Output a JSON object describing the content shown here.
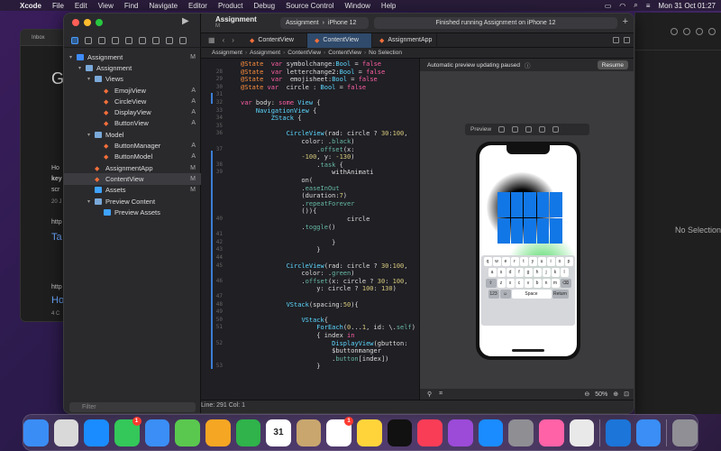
{
  "menubar": {
    "app": "Xcode",
    "items": [
      "File",
      "Edit",
      "View",
      "Find",
      "Navigate",
      "Editor",
      "Product",
      "Debug",
      "Source Control",
      "Window",
      "Help"
    ],
    "clock": "Mon 31 Oct  01:27"
  },
  "background_browser": {
    "tab": "Inbox",
    "heading": "G",
    "lines": [
      "Ho",
      "key",
      "scr",
      "20 J",
      "http",
      "Ta",
      "http",
      "Ho",
      "4 C"
    ]
  },
  "right_window": {
    "placeholder": "No Selection"
  },
  "sidebar": {
    "filter_placeholder": "Filter",
    "items": [
      {
        "label": "Assignment",
        "status": "M",
        "icon": "project-icon",
        "indent": 0,
        "disclosure": "▾"
      },
      {
        "label": "Assignment",
        "status": "",
        "icon": "folder-icon",
        "indent": 1,
        "disclosure": "▾"
      },
      {
        "label": "Views",
        "status": "",
        "icon": "folder-icon",
        "indent": 2,
        "disclosure": "▾"
      },
      {
        "label": "EmojiView",
        "status": "A",
        "icon": "swift-file-icon",
        "indent": 3,
        "disclosure": ""
      },
      {
        "label": "CircleView",
        "status": "A",
        "icon": "swift-file-icon",
        "indent": 3,
        "disclosure": ""
      },
      {
        "label": "DisplayView",
        "status": "A",
        "icon": "swift-file-icon",
        "indent": 3,
        "disclosure": ""
      },
      {
        "label": "ButtonView",
        "status": "A",
        "icon": "swift-file-icon",
        "indent": 3,
        "disclosure": ""
      },
      {
        "label": "Model",
        "status": "",
        "icon": "folder-icon",
        "indent": 2,
        "disclosure": "▾"
      },
      {
        "label": "ButtonManager",
        "status": "A",
        "icon": "swift-file-icon",
        "indent": 3,
        "disclosure": ""
      },
      {
        "label": "ButtonModel",
        "status": "A",
        "icon": "swift-file-icon",
        "indent": 3,
        "disclosure": ""
      },
      {
        "label": "AssignmentApp",
        "status": "M",
        "icon": "swift-file-icon",
        "indent": 2,
        "disclosure": ""
      },
      {
        "label": "ContentView",
        "status": "M",
        "icon": "swift-file-icon",
        "indent": 2,
        "disclosure": "",
        "selected": true
      },
      {
        "label": "Assets",
        "status": "M",
        "icon": "asset-catalog-icon",
        "indent": 2,
        "disclosure": ""
      },
      {
        "label": "Preview Content",
        "status": "",
        "icon": "folder-icon",
        "indent": 2,
        "disclosure": "▾"
      },
      {
        "label": "Preview Assets",
        "status": "",
        "icon": "asset-catalog-icon",
        "indent": 3,
        "disclosure": ""
      }
    ]
  },
  "toolbar": {
    "title": "Assignment",
    "subtitle": "M",
    "scheme": "Assignment",
    "device": "iPhone 12",
    "status": "Finished running Assignment on iPhone 12",
    "add": "+"
  },
  "tabs": [
    {
      "label": "ContentView",
      "active": false
    },
    {
      "label": "ContentView",
      "active": true
    },
    {
      "label": "AssignmentApp",
      "active": false
    }
  ],
  "breadcrumbs": [
    "Assignment",
    "Assignment",
    "ContentView",
    "ContentView",
    "No Selection"
  ],
  "editor": {
    "lines": [
      {
        "n": "",
        "t": "@State  var symbolchange:Bool = false"
      },
      {
        "n": "28",
        "t": "@State  var letterchange2:Bool = false"
      },
      {
        "n": "29",
        "t": "@State  var  emojisheet:Bool = false"
      },
      {
        "n": "30",
        "t": "@State var  circle : Bool = false"
      },
      {
        "n": "31",
        "t": ""
      },
      {
        "n": "32",
        "t": "var body: some View {"
      },
      {
        "n": "33",
        "t": "    NavigationView {"
      },
      {
        "n": "34",
        "t": "        ZStack {"
      },
      {
        "n": "35",
        "t": ""
      },
      {
        "n": "36",
        "t": "            CircleView(rad: circle ? 30:100,"
      },
      {
        "n": "",
        "t": "                color: .black)"
      },
      {
        "n": "37",
        "t": "                    .offset(x:"
      },
      {
        "n": "",
        "t": "                -100, y: -130)"
      },
      {
        "n": "38",
        "t": "                    .task {"
      },
      {
        "n": "39",
        "t": "                        withAnimati"
      },
      {
        "n": "",
        "t": "                on("
      },
      {
        "n": "",
        "t": "                .easeInOut"
      },
      {
        "n": "",
        "t": "                (duration:7)"
      },
      {
        "n": "",
        "t": "                .repeatForever"
      },
      {
        "n": "",
        "t": "                ()){"
      },
      {
        "n": "40",
        "t": "                            circle"
      },
      {
        "n": "",
        "t": "                .toggle()"
      },
      {
        "n": "41",
        "t": ""
      },
      {
        "n": "42",
        "t": "                        }"
      },
      {
        "n": "43",
        "t": "                    }"
      },
      {
        "n": "44",
        "t": ""
      },
      {
        "n": "45",
        "t": "            CircleView(rad: circle ? 30:100,"
      },
      {
        "n": "",
        "t": "                color: .green)"
      },
      {
        "n": "46",
        "t": "                .offset(x: circle ? 30: 100,"
      },
      {
        "n": "",
        "t": "                    y: circle ? 100: 130)"
      },
      {
        "n": "47",
        "t": ""
      },
      {
        "n": "48",
        "t": "            VStack(spacing:50){"
      },
      {
        "n": "49",
        "t": ""
      },
      {
        "n": "50",
        "t": "                VStack{"
      },
      {
        "n": "51",
        "t": "                    ForEach(0...1, id: \\.self)"
      },
      {
        "n": "",
        "t": "                    { index in"
      },
      {
        "n": "52",
        "t": "                        DisplayView(gbutton:"
      },
      {
        "n": "",
        "t": "                        $buttonmanger"
      },
      {
        "n": "",
        "t": "                        .button[index])"
      },
      {
        "n": "53",
        "t": "                    }"
      }
    ]
  },
  "canvas": {
    "banner": "Automatic preview updating paused",
    "resume": "Resume",
    "preview_label": "Preview",
    "zoom": "50%",
    "grid_cells": 10
  },
  "keyboard": {
    "row1": [
      "q",
      "w",
      "e",
      "r",
      "t",
      "y",
      "u",
      "i",
      "o",
      "p"
    ],
    "row2": [
      "a",
      "s",
      "d",
      "f",
      "g",
      "h",
      "j",
      "k",
      "l"
    ],
    "row3": [
      "⇧",
      "z",
      "x",
      "c",
      "v",
      "b",
      "n",
      "m",
      "⌫"
    ],
    "row4": [
      "123",
      "☺",
      "Space",
      "Return"
    ]
  },
  "statusbar": {
    "position": "Line: 291  Col: 1"
  },
  "dock": {
    "apps": [
      {
        "name": "Finder",
        "color": "#3b8df6",
        "badge": ""
      },
      {
        "name": "Launchpad",
        "color": "#d9d9d9",
        "badge": ""
      },
      {
        "name": "Safari",
        "color": "#1a8cff",
        "badge": ""
      },
      {
        "name": "Messages",
        "color": "#34c759",
        "badge": "1"
      },
      {
        "name": "Mail",
        "color": "#3a8ef6",
        "badge": ""
      },
      {
        "name": "Maps",
        "color": "#5ac84e",
        "badge": ""
      },
      {
        "name": "Photos",
        "color": "#f5a623",
        "badge": ""
      },
      {
        "name": "FaceTime",
        "color": "#2fb34a",
        "badge": ""
      },
      {
        "name": "Calendar",
        "color": "#ffffff",
        "badge": "",
        "text": "31"
      },
      {
        "name": "Contacts",
        "color": "#c8a66e",
        "badge": ""
      },
      {
        "name": "Reminders",
        "color": "#ffffff",
        "badge": "1"
      },
      {
        "name": "Notes",
        "color": "#ffd43b",
        "badge": ""
      },
      {
        "name": "TV",
        "color": "#111111",
        "badge": ""
      },
      {
        "name": "Music",
        "color": "#fa3d57",
        "badge": ""
      },
      {
        "name": "Podcasts",
        "color": "#9b4bd8",
        "badge": ""
      },
      {
        "name": "App Store",
        "color": "#1a8cff",
        "badge": ""
      },
      {
        "name": "System Preferences",
        "color": "#8e8e93",
        "badge": ""
      },
      {
        "name": "Keynote",
        "color": "#ff62a7",
        "badge": ""
      },
      {
        "name": "Preview",
        "color": "#e9e9e9",
        "badge": ""
      },
      {
        "name": "Xcode",
        "color": "#1c75d8",
        "badge": ""
      },
      {
        "name": "Xcode Beta",
        "color": "#3a8ef6",
        "badge": ""
      },
      {
        "name": "Trash",
        "color": "#8f8f95",
        "badge": ""
      }
    ]
  }
}
